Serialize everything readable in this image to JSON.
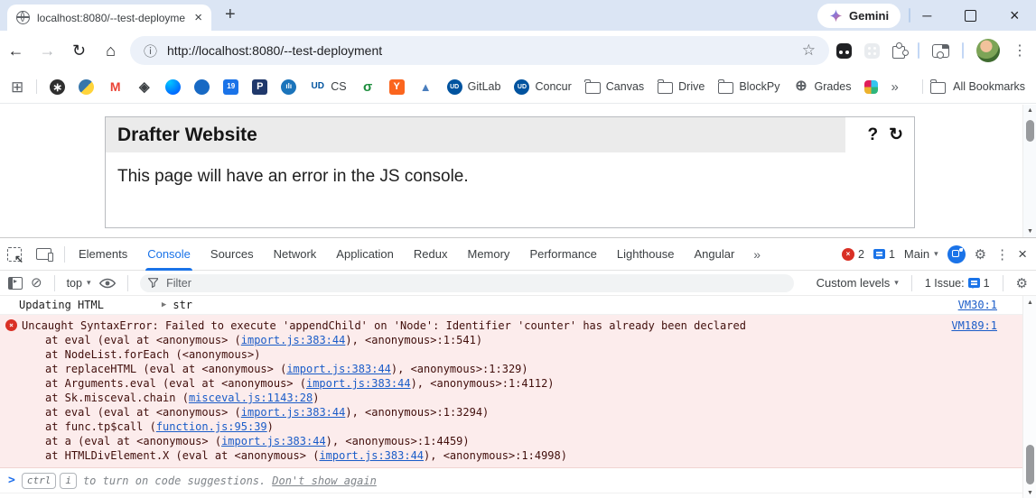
{
  "window": {
    "tab_title": "localhost:8080/--test-deployme",
    "gemini_label": "Gemini"
  },
  "toolbar": {
    "url": "http://localhost:8080/--test-deployment"
  },
  "bookmarks": {
    "overflow": "»",
    "all_label": "All Bookmarks",
    "items": [
      {
        "name": "chatgpt",
        "glyph": "∗",
        "bg": "#2f2f2f",
        "fg": "#ffffff",
        "shape": "circle",
        "size": 13
      },
      {
        "name": "python",
        "glyph": "",
        "bg": "grad-python",
        "fg": "#ffffff",
        "shape": "circle"
      },
      {
        "name": "gmail",
        "glyph": "M",
        "bg": "none",
        "fg": "#ea4335",
        "size": 14,
        "bold": true
      },
      {
        "name": "compass",
        "glyph": "◈",
        "bg": "none",
        "fg": "#3c4043",
        "size": 15
      },
      {
        "name": "messenger",
        "glyph": "",
        "bg": "grad-messenger",
        "fg": "#ffffff",
        "shape": "circle"
      },
      {
        "name": "noaa",
        "glyph": "",
        "bg": "#1769c4",
        "fg": "#ffffff",
        "shape": "circle"
      },
      {
        "name": "calendar",
        "glyph": "19",
        "bg": "#1a73e8",
        "fg": "#ffffff",
        "size": 8
      },
      {
        "name": "p-badge",
        "glyph": "P",
        "bg": "#20386b",
        "fg": "#ffffff",
        "size": 11
      },
      {
        "name": "chart-blue",
        "glyph": "ılı",
        "bg": "#1b74bb",
        "fg": "#ffffff",
        "shape": "circle",
        "size": 8
      },
      {
        "name": "ud-cs",
        "glyph": "UD",
        "bg": "none",
        "fg": "#00539f",
        "size": 10,
        "bold": true,
        "label": "CS"
      },
      {
        "name": "sigma",
        "glyph": "σ",
        "bg": "none",
        "fg": "#1e8e3e",
        "size": 15,
        "bold": true
      },
      {
        "name": "ycombinator",
        "glyph": "Y",
        "bg": "#fb651e",
        "fg": "#ffffff",
        "size": 11
      },
      {
        "name": "blue-arrow",
        "glyph": "▲",
        "bg": "none",
        "fg": "#4a7ebd",
        "size": 13
      },
      {
        "name": "ud-gitlab",
        "glyph": "UD",
        "bg": "#00539f",
        "fg": "#ffffff",
        "shape": "circle",
        "size": 7,
        "bold": true,
        "label": "GitLab"
      },
      {
        "name": "ud-concur",
        "glyph": "UD",
        "bg": "#00539f",
        "fg": "#ffffff",
        "shape": "circle",
        "size": 7,
        "bold": true,
        "label": "Concur"
      },
      {
        "name": "canvas",
        "icon": "folder",
        "label": "Canvas"
      },
      {
        "name": "drive",
        "icon": "folder",
        "label": "Drive"
      },
      {
        "name": "blockpy",
        "icon": "folder",
        "label": "BlockPy"
      },
      {
        "name": "grades",
        "glyph": "⊕",
        "bg": "none",
        "fg": "#5f6368",
        "size": 16,
        "label": "Grades"
      },
      {
        "name": "slack",
        "icon": "slack",
        "label": ""
      }
    ]
  },
  "page": {
    "title": "Drafter Website",
    "help_label": "?",
    "reload_label": "↻",
    "body": "This page will have an error in the JS console."
  },
  "devtools": {
    "tabs": [
      {
        "label": "Elements"
      },
      {
        "label": "Console",
        "active": true
      },
      {
        "label": "Sources"
      },
      {
        "label": "Network"
      },
      {
        "label": "Application"
      },
      {
        "label": "Redux"
      },
      {
        "label": "Memory"
      },
      {
        "label": "Performance"
      },
      {
        "label": "Lighthouse"
      },
      {
        "label": "Angular"
      }
    ],
    "more_label": "»",
    "error_count": "2",
    "message_count": "1",
    "main_label": "Main",
    "toolbar": {
      "context_label": "top",
      "filter_placeholder": "Filter",
      "levels_label": "Custom levels",
      "issues_label": "1 Issue:",
      "issues_count": "1"
    },
    "console": {
      "first_row": {
        "text": "Updating HTML",
        "value_type": "str",
        "source_link": "VM30:1"
      },
      "error": {
        "message": "Uncaught SyntaxError: Failed to execute 'appendChild' on 'Node': Identifier 'counter' has already been declared",
        "source_link": "VM189:1",
        "stack": [
          {
            "pre": "at eval (eval at <anonymous> (",
            "link": "import.js:383:44",
            "post": "), <anonymous>:1:541)"
          },
          {
            "pre": "at NodeList.forEach (<anonymous>)",
            "link": "",
            "post": ""
          },
          {
            "pre": "at replaceHTML (eval at <anonymous> (",
            "link": "import.js:383:44",
            "post": "), <anonymous>:1:329)"
          },
          {
            "pre": "at Arguments.eval (eval at <anonymous> (",
            "link": "import.js:383:44",
            "post": "), <anonymous>:1:4112)"
          },
          {
            "pre": "at Sk.misceval.chain (",
            "link": "misceval.js:1143:28",
            "post": ")"
          },
          {
            "pre": "at eval (eval at <anonymous> (",
            "link": "import.js:383:44",
            "post": "), <anonymous>:1:3294)"
          },
          {
            "pre": "at func.tp$call (",
            "link": "function.js:95:39",
            "post": ")"
          },
          {
            "pre": "at a (eval at <anonymous> (",
            "link": "import.js:383:44",
            "post": "), <anonymous>:1:4459)"
          },
          {
            "pre": "at HTMLDivElement.X (eval at <anonymous> (",
            "link": "import.js:383:44",
            "post": "), <anonymous>:1:4998)"
          }
        ]
      },
      "prompt": {
        "keys": [
          "ctrl",
          "i"
        ],
        "text": "to turn on code suggestions.",
        "link_label": "Don't show again"
      }
    }
  },
  "icons": {
    "close": "×",
    "plus": "+",
    "back": "←",
    "forward": "→",
    "reload": "↻",
    "home": "⌂",
    "info": "ⓘ",
    "star": "☆",
    "kebab": "⋮",
    "minimize": "─",
    "caret": "▾",
    "grid": "⊞",
    "clear": "⊘",
    "gear": "⚙",
    "expander": "▶",
    "up": "▲",
    "down": "▼",
    "cross": "×",
    "prompt": ">"
  },
  "colors": {
    "accent": "#1a73e8",
    "error_red": "#d93025",
    "error_bg": "#fcecec",
    "error_text": "#410e0b",
    "link_blue": "#1a5cc8"
  }
}
